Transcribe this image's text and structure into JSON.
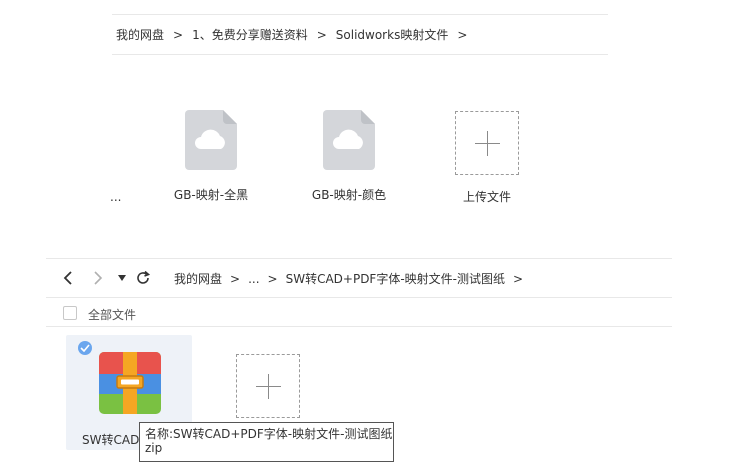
{
  "top_panel": {
    "breadcrumb": {
      "items": [
        "我的网盘",
        "1、免费分享赠送资料",
        "Solidworks映射文件"
      ],
      "separator": ">"
    },
    "truncated_item_text": "...",
    "files": [
      {
        "name": "GB-映射-全黑",
        "icon": "cloud-document-icon"
      },
      {
        "name": "GB-映射-颜色",
        "icon": "cloud-document-icon"
      }
    ],
    "upload_label": "上传文件"
  },
  "bottom_panel": {
    "nav": {
      "back_icon": "chevron-left-icon",
      "forward_icon": "chevron-right-icon",
      "dropdown_icon": "caret-down-icon",
      "refresh_icon": "refresh-icon"
    },
    "breadcrumb": {
      "items": [
        "我的网盘",
        "...",
        "SW转CAD+PDF字体-映射文件-测试图纸"
      ],
      "separator": ">"
    },
    "select_all_label": "全部文件",
    "selected_file": {
      "name_truncated": "SW转CAD",
      "icon": "zip-archive-icon"
    },
    "tooltip_text": "名称:SW转CAD+PDF字体-映射文件-测试图纸.",
    "tooltip_text_line2": "zip"
  },
  "colors": {
    "accent_check": "#6aa6ee",
    "selected_bg": "#eef2f8",
    "doc_icon_gray": "#d4d6da",
    "zip_red": "#e8534d",
    "zip_green": "#7ac142",
    "zip_blue": "#4a90e2",
    "zip_orange": "#f5a623"
  }
}
